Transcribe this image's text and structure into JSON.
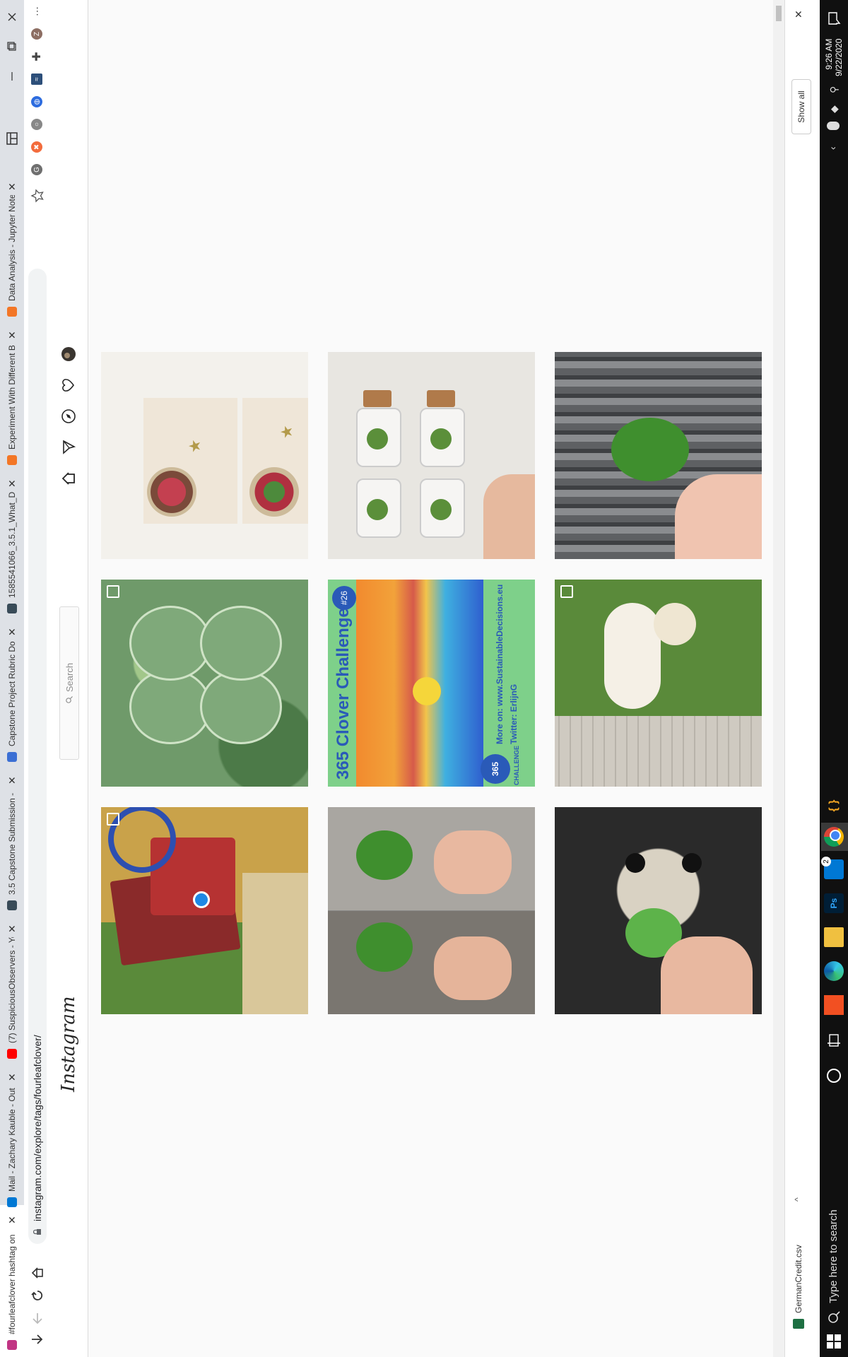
{
  "browser": {
    "tabs": [
      {
        "title": "#fourleafclover hashtag on",
        "favicon_color": "#c13584",
        "active": true
      },
      {
        "title": "Mail - Zachary Kauble - Out",
        "favicon_color": "#0078d4",
        "active": false
      },
      {
        "title": "(7) SuspiciousObservers - Yo",
        "favicon_color": "#ff0000",
        "active": false
      },
      {
        "title": "3.5 Capstone Submission -",
        "favicon_color": "#394b58",
        "active": false
      },
      {
        "title": "Capstone Project Rubric Do",
        "favicon_color": "#3b6fd4",
        "active": false
      },
      {
        "title": "1585541066_3.5.1_What_Do",
        "favicon_color": "#394b58",
        "active": false
      },
      {
        "title": "Experiment With Different B",
        "favicon_color": "#f37626",
        "active": false
      },
      {
        "title": "Data Analysis - Jupyter Note",
        "favicon_color": "#f37626",
        "active": false
      }
    ],
    "address": "instagram.com/explore/tags/fourleafclover/",
    "profile_initial": "Z",
    "close_glyph": "✕"
  },
  "instagram": {
    "logo": "Instagram",
    "search_placeholder": "Search"
  },
  "tiles": [
    {
      "name": "resin-clover-pendant-post",
      "multi": false,
      "bg": "#f3f1ec",
      "accent": "#c4404a"
    },
    {
      "name": "clover-bottles-post",
      "multi": false,
      "bg": "#e8e6e1",
      "accent": "#b07a4a"
    },
    {
      "name": "clover-in-hand-post",
      "multi": false,
      "bg": "#6d6f72",
      "accent": "#3f8f2e"
    },
    {
      "name": "variegated-clover-post",
      "multi": true,
      "bg": "#5f8a5a",
      "accent": "#8fb58a"
    },
    {
      "name": "clover-challenge-post",
      "multi": false,
      "bg": "#7ed08a",
      "accent": "#f28a2e"
    },
    {
      "name": "dog-on-grass-post",
      "multi": true,
      "bg": "#5a8a3a",
      "accent": "#f5f0e6"
    },
    {
      "name": "vintage-books-post",
      "multi": true,
      "bg": "#8a2a2a",
      "accent": "#2d4fb0"
    },
    {
      "name": "two-clovers-hands-post",
      "multi": false,
      "bg": "#8a8a88",
      "accent": "#3f8f2e"
    },
    {
      "name": "pomeranian-clover-post",
      "multi": false,
      "bg": "#2a2a2a",
      "accent": "#5db34a"
    }
  ],
  "challenge": {
    "title": "365 Clover Challenge",
    "badge": "#26",
    "logo_number": "365",
    "logo_label": "CHALLENGE",
    "more": "More on: www.SustainableDecisions.eu",
    "twitter": "Twitter: ErlijnG"
  },
  "downloads": {
    "file": "GermanCredit.csv",
    "chevron": "^"
  },
  "notifications": {
    "show_all": "Show all",
    "close": "✕"
  },
  "taskbar": {
    "search_placeholder": "Type here to search",
    "time": "9:26 AM",
    "date": "9/22/2020",
    "mail_badge": "2",
    "ps_label": "Ps",
    "brackets": "{ }"
  }
}
